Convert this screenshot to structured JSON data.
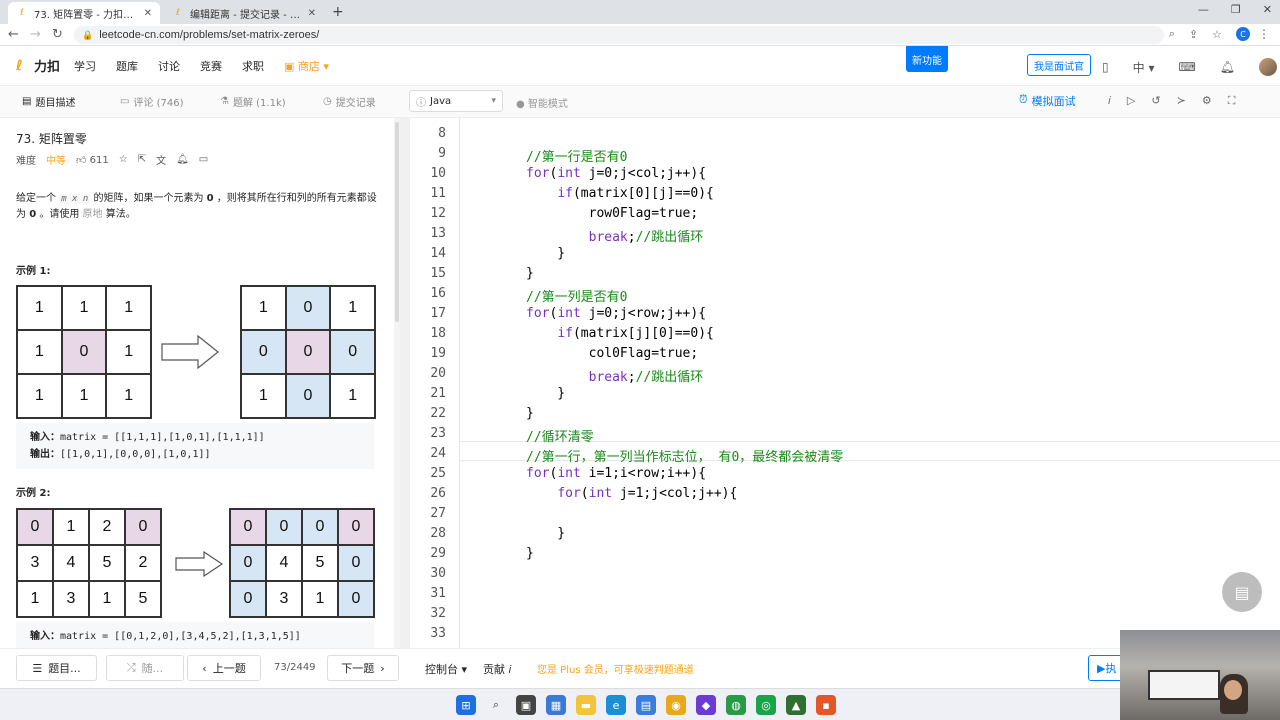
{
  "browser": {
    "tabs": [
      {
        "title": "73. 矩阵置零 - 力扣（LeetCode）",
        "active": true
      },
      {
        "title": "编辑距离 - 提交记录 - 力扣（Lee",
        "active": false
      }
    ],
    "url": "leetcode-cn.com/problems/set-matrix-zeroes/",
    "profile_initial": "C"
  },
  "sitenav": {
    "logo_text": "力扣",
    "items": [
      "学习",
      "题库",
      "讨论",
      "竞赛",
      "求职"
    ],
    "shop": "商店",
    "new_feature": "新功能",
    "interviewer": "我是面试官",
    "lang_toggle": "中"
  },
  "subbar": {
    "tabs": [
      "题目描述",
      "评论 (746)",
      "题解 (1.1k)",
      "提交记录"
    ],
    "language": "Java",
    "smart_mode": "智能模式",
    "mock": "模拟面试"
  },
  "problem": {
    "title": "73. 矩阵置零",
    "difficulty_label": "难度",
    "difficulty": "中等",
    "likes": "611",
    "desc_1": "给定一个",
    "desc_code": "m x n",
    "desc_2": "的矩阵，如果一个元素为",
    "desc_zero": "0",
    "desc_3": "，则将其所在行和列的所有元素都设为",
    "desc_zero2": "0",
    "desc_4": "。请使用",
    "desc_inplace": "原地",
    "desc_5": "算法。",
    "example1_label": "示例 1:",
    "example1_in_grid": [
      "1",
      "1",
      "1",
      "1",
      "0",
      "1",
      "1",
      "1",
      "1"
    ],
    "example1_out_grid": [
      "1",
      "0",
      "1",
      "0",
      "0",
      "0",
      "1",
      "0",
      "1"
    ],
    "example1_input_label": "输入：",
    "example1_input": "matrix = [[1,1,1],[1,0,1],[1,1,1]]",
    "example1_output_label": "输出：",
    "example1_output": "[[1,0,1],[0,0,0],[1,0,1]]",
    "example2_label": "示例 2:",
    "example2_in_grid": [
      "0",
      "1",
      "2",
      "0",
      "3",
      "4",
      "5",
      "2",
      "1",
      "3",
      "1",
      "5"
    ],
    "example2_out_grid": [
      "0",
      "0",
      "0",
      "0",
      "0",
      "4",
      "5",
      "0",
      "0",
      "3",
      "1",
      "0"
    ],
    "example2_input_label": "输入：",
    "example2_input": "matrix = [[0,1,2,0],[3,4,5,2],[1,3,1,5]]"
  },
  "editor": {
    "lines": [
      {
        "n": "8",
        "text": ""
      },
      {
        "n": "9",
        "text": "//第一行是否有0"
      },
      {
        "n": "10",
        "text": "for(int j=0;j<col;j++){"
      },
      {
        "n": "11",
        "text": "    if(matrix[0][j]==0){"
      },
      {
        "n": "12",
        "text": "        row0Flag=true;"
      },
      {
        "n": "13",
        "text": "        break;//跳出循环"
      },
      {
        "n": "14",
        "text": "    }"
      },
      {
        "n": "15",
        "text": "}"
      },
      {
        "n": "16",
        "text": "//第一列是否有0"
      },
      {
        "n": "17",
        "text": "for(int j=0;j<row;j++){"
      },
      {
        "n": "18",
        "text": "    if(matrix[j][0]==0){"
      },
      {
        "n": "19",
        "text": "        col0Flag=true;"
      },
      {
        "n": "20",
        "text": "        break;//跳出循环"
      },
      {
        "n": "21",
        "text": "    }"
      },
      {
        "n": "22",
        "text": "}"
      },
      {
        "n": "23",
        "text": "//循环清零"
      },
      {
        "n": "24",
        "text": "//第一行，第一列当作标志位， 有0，最终都会被清零"
      },
      {
        "n": "25",
        "text": "for(int i=1;i<row;i++){"
      },
      {
        "n": "26",
        "text": "    for(int j=1;j<col;j++){"
      },
      {
        "n": "27",
        "text": ""
      },
      {
        "n": "28",
        "text": "    }"
      },
      {
        "n": "29",
        "text": "}"
      },
      {
        "n": "30",
        "text": ""
      },
      {
        "n": "31",
        "text": ""
      },
      {
        "n": "32",
        "text": ""
      },
      {
        "n": "33",
        "text": ""
      }
    ]
  },
  "bottom": {
    "list_btn": "题目...",
    "random_btn": "随...",
    "prev_btn": "上一题",
    "page": "73/2449",
    "next_btn": "下一题",
    "console": "控制台",
    "contribute": "贡献",
    "plus_text": "您是 Plus 会员，可享极速判题通道",
    "run": "执"
  },
  "colors": {
    "accent": "#007aff",
    "orange": "#ffa116",
    "pink_cell": "#e8d7e6",
    "blue_cell": "#d6e6f5",
    "comment": "#1a8a1a",
    "keyword": "#7b2fbe"
  }
}
